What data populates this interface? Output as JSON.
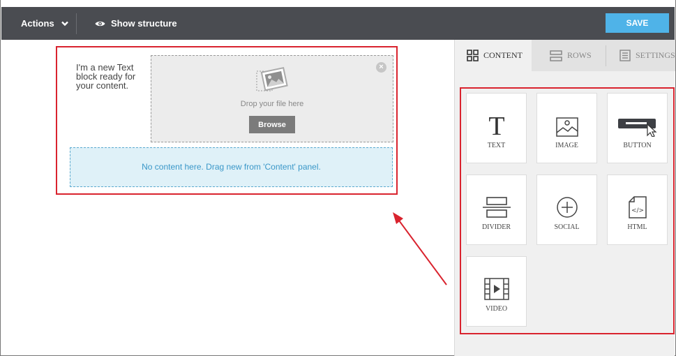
{
  "toolbar": {
    "actions_label": "Actions",
    "show_structure_label": "Show structure",
    "save_label": "SAVE"
  },
  "canvas": {
    "text_block": "I'm a new Text block ready for your content.",
    "dropzone_text": "Drop your file here",
    "browse_label": "Browse",
    "empty_row_text": "No content here. Drag new from 'Content' panel."
  },
  "panel": {
    "tabs": [
      {
        "label": "CONTENT",
        "icon": "grid-icon",
        "active": true
      },
      {
        "label": "ROWS",
        "icon": "rows-icon",
        "active": false
      },
      {
        "label": "SETTINGS",
        "icon": "settings-icon",
        "active": false
      }
    ],
    "blocks": [
      {
        "label": "TEXT",
        "icon": "text-icon"
      },
      {
        "label": "IMAGE",
        "icon": "image-icon"
      },
      {
        "label": "BUTTON",
        "icon": "button-icon"
      },
      {
        "label": "DIVIDER",
        "icon": "divider-icon"
      },
      {
        "label": "SOCIAL",
        "icon": "social-icon"
      },
      {
        "label": "HTML",
        "icon": "html-icon"
      },
      {
        "label": "VIDEO",
        "icon": "video-icon"
      }
    ]
  },
  "colors": {
    "toolbar_bg": "#4a4c51",
    "save_button": "#4fb3e8",
    "highlight_red": "#d9232e",
    "empty_zone_bg": "#dff1f8",
    "empty_zone_text": "#3a97c8"
  }
}
